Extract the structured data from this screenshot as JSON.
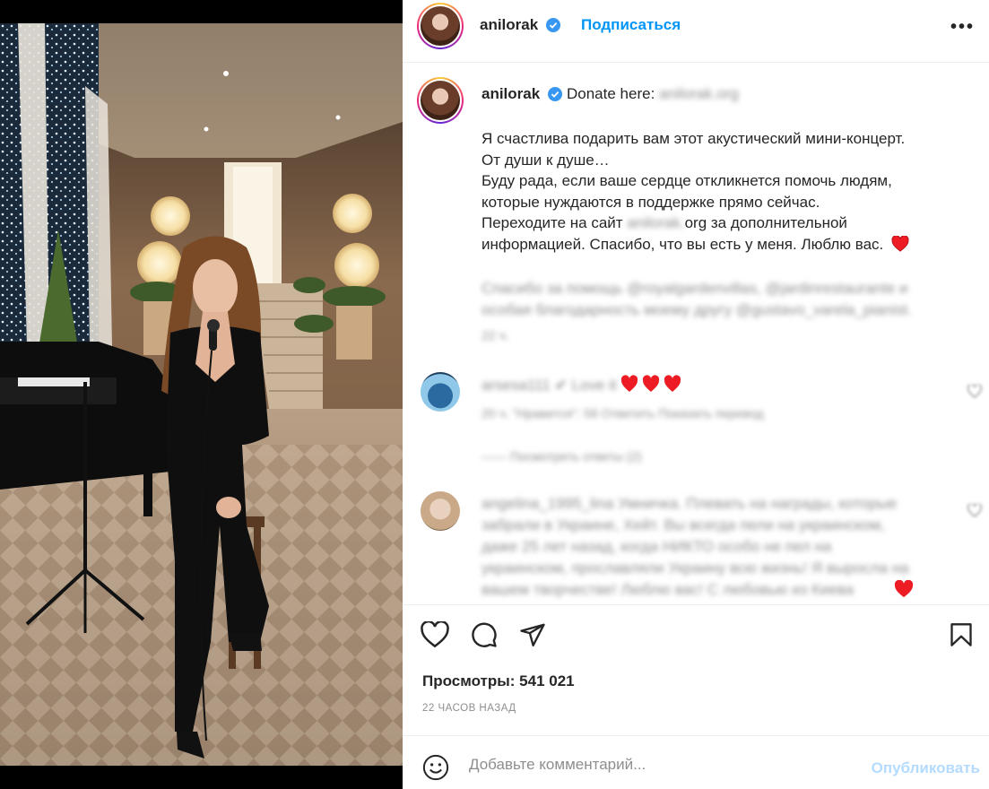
{
  "post": {
    "username": "anilorak",
    "follow_label": "Подписаться",
    "more_label": "•••"
  },
  "caption": {
    "username": "anilorak",
    "donate_prefix": "Donate here:",
    "donate_link": "anilorak.org",
    "lines": [
      "Я счастлива подарить вам этот акустический мини-концерт.",
      "От души к душе…",
      "Буду рада, если ваше сердце откликнется помочь людям,",
      "которые нуждаются в поддержке прямо сейчас."
    ],
    "site_prefix": "Переходите на сайт",
    "site_blur": "anilorak.",
    "site_suffix": "org за дополнительной",
    "last_line": "информацией. Спасибо, что вы есть у меня. Люблю вас.",
    "thanks_line1": "Спасибо за помощь @royalgardenvillas, @jardinrestaurante и",
    "thanks_line2": "особая благодарность моему другу @gustavo_varela_pianist.",
    "time": "22 ч."
  },
  "comments": [
    {
      "text": "arsesa111 ✔ Love it",
      "meta": "20 ч.    \"Нравится\": 58    Ответить    Показать перевод",
      "view_replies": "——    Посмотреть ответы (2)"
    },
    {
      "text_lines": [
        "angelina_1995_lina Умничка. Плевать на награды, которые",
        "забрали в Украине, Хейт. Вы всегда пели на украинском,",
        "даже 25 лет назад, когда НИКТО особо не пел на",
        "украинском, прославляли Украину всю жизнь! Я выросла на",
        "вашем творчестве! Люблю вас! С любовью из Киева"
      ]
    }
  ],
  "stats": {
    "views_label": "Просмотры:",
    "views_value": "541 021",
    "time_ago": "22 ЧАСОВ НАЗАД"
  },
  "composer": {
    "placeholder": "Добавьте комментарий...",
    "publish_label": "Опубликовать"
  },
  "colors": {
    "accent": "#0095f6",
    "verified": "#3897f0",
    "heart": "#ed4956",
    "publish_disabled": "#b3dbff"
  },
  "icons": [
    "heart-icon",
    "comment-icon",
    "share-icon",
    "bookmark-icon",
    "emoji-icon",
    "verified-icon",
    "more-icon"
  ]
}
